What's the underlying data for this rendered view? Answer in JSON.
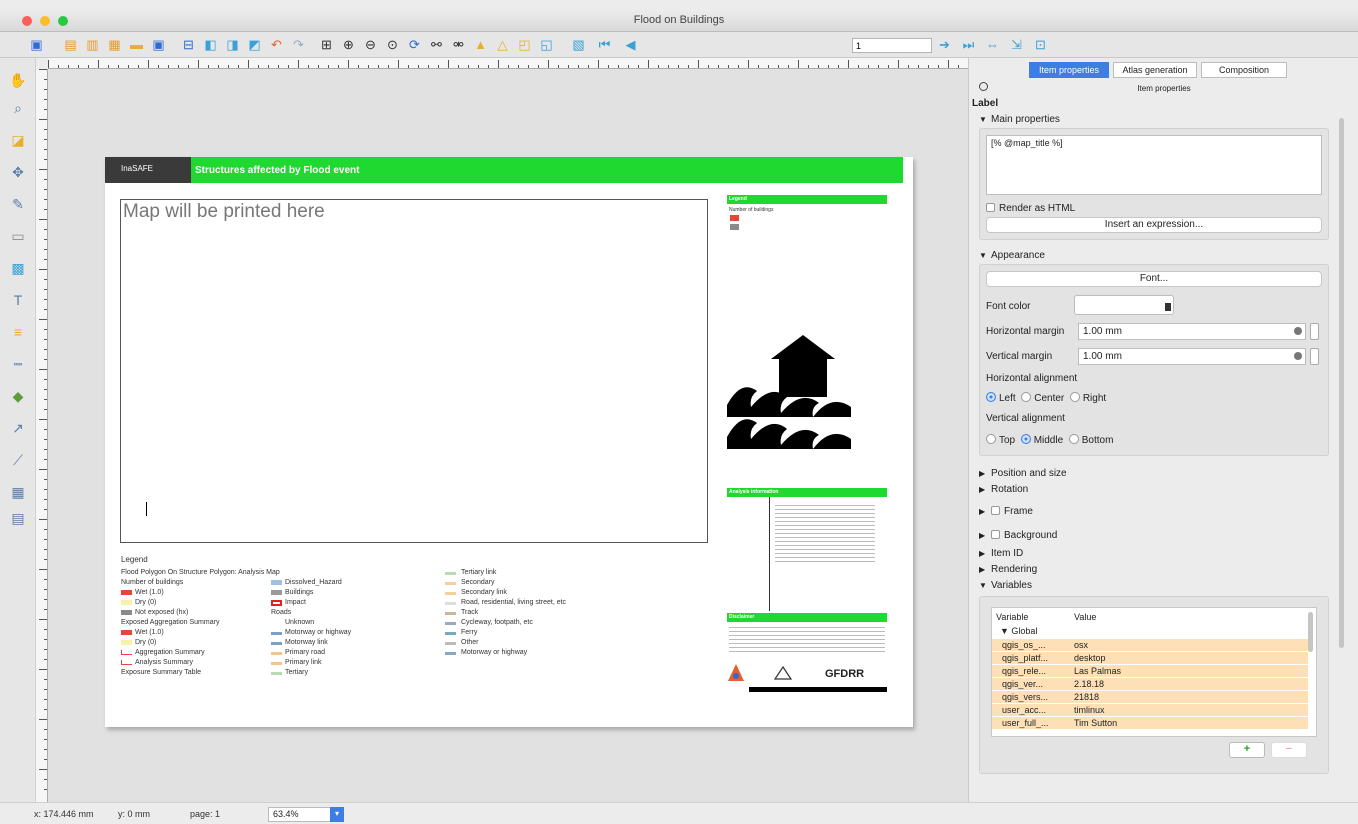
{
  "window": {
    "title": "Flood on Buildings"
  },
  "toolbar": {
    "atlas_page_value": "1"
  },
  "panel": {
    "tabs": [
      {
        "label": "Item properties",
        "active": true
      },
      {
        "label": "Atlas generation",
        "active": false
      },
      {
        "label": "Composition",
        "active": false
      }
    ],
    "title": "Item properties",
    "item_type": "Label",
    "sections": {
      "main_properties": "Main properties",
      "appearance": "Appearance",
      "position_and_size": "Position and size",
      "rotation": "Rotation",
      "frame": "Frame",
      "background": "Background",
      "item_id": "Item ID",
      "rendering": "Rendering",
      "variables": "Variables"
    },
    "label_text": "[% @map_title %]",
    "render_html_label": "Render as HTML",
    "insert_expression_label": "Insert an expression...",
    "font_button": "Font...",
    "font_color_label": "Font color",
    "h_margin_label": "Horizontal margin",
    "h_margin_value": "1.00 mm",
    "v_margin_label": "Vertical margin",
    "v_margin_value": "1.00 mm",
    "h_align_label": "Horizontal alignment",
    "h_align_options": [
      "Left",
      "Center",
      "Right"
    ],
    "v_align_label": "Vertical alignment",
    "v_align_options": [
      "Top",
      "Middle",
      "Bottom"
    ],
    "variables_table": {
      "col_variable": "Variable",
      "col_value": "Value",
      "group": "Global",
      "rows": [
        {
          "name": "qgis_os_...",
          "value": "osx"
        },
        {
          "name": "qgis_platf...",
          "value": "desktop"
        },
        {
          "name": "qgis_rele...",
          "value": "Las Palmas"
        },
        {
          "name": "qgis_ver...",
          "value": "2.18.18"
        },
        {
          "name": "qgis_vers...",
          "value": "21818"
        },
        {
          "name": "user_acc...",
          "value": "timlinux"
        },
        {
          "name": "user_full_...",
          "value": "Tim Sutton"
        }
      ],
      "add_glyph": "+",
      "remove_glyph": "−"
    }
  },
  "layout": {
    "header_logo_text": "InaSAFE",
    "header_title": "Structures affected by Flood event",
    "map_placeholder": "Map will be printed here",
    "legend_box_title": "Legend",
    "legend_box_sub": "Number of buildings",
    "analysis_title": "Analysis information",
    "disclaimer_title": "Disclaimer",
    "gfdrr_text": "GFDRR",
    "legend_title": "Legend",
    "legend_items": [
      {
        "text": "Flood Polygon On Structure Polygon: Analysis Map",
        "color": ""
      },
      {
        "text": "Number of buildings",
        "color": ""
      },
      {
        "text": "Wet (1.0)",
        "color": "#e8443a"
      },
      {
        "text": "Dry (0)",
        "color": "#f6f0a8"
      },
      {
        "text": "Not exposed (hx)",
        "color": "#8a8a8a"
      },
      {
        "text": "Exposed Aggregation Summary",
        "color": ""
      },
      {
        "text": "Wet (1.0)",
        "color": "#e8443a"
      },
      {
        "text": "Dry (0)",
        "color": "#f6f0a8"
      },
      {
        "text": "Aggregation Summary",
        "color": "#e8443a"
      },
      {
        "text": "Analysis Summary",
        "color": "#e8443a"
      },
      {
        "text": "Exposure Summary Table",
        "color": ""
      }
    ],
    "legend_col2": [
      {
        "text": "Dissolved_Hazard",
        "color": "#9fc0e0"
      },
      {
        "text": "Buildings",
        "color": "#9a9a9a"
      },
      {
        "text": "Impact",
        "color": "#d22"
      },
      {
        "text": "Roads",
        "color": ""
      },
      {
        "text": "Unknown",
        "color": ""
      },
      {
        "text": "Motorway or highway",
        "color": "#7aa0c8"
      },
      {
        "text": "Motorway link",
        "color": "#7aa0c8"
      },
      {
        "text": "Primary road",
        "color": "#f5c48a"
      },
      {
        "text": "Primary link",
        "color": "#f5c48a"
      },
      {
        "text": "Tertiary",
        "color": "#b9d9b2"
      }
    ],
    "legend_col3": [
      {
        "text": "Tertiary link",
        "color": "#b9d9b2"
      },
      {
        "text": "Secondary",
        "color": "#f2d0a0"
      },
      {
        "text": "Secondary link",
        "color": "#f2d0a0"
      },
      {
        "text": "Road, residential, living street, etc",
        "color": "#ddd"
      },
      {
        "text": "Track",
        "color": "#c9b89a"
      },
      {
        "text": "Cycleway, footpath, etc",
        "color": "#9ab"
      },
      {
        "text": "Ferry",
        "color": "#7ab"
      },
      {
        "text": "Other",
        "color": "#bbb"
      },
      {
        "text": "Motorway or highway",
        "color": "#8aa6c4"
      }
    ]
  },
  "status": {
    "x": "x: 174.446 mm",
    "y": "y: 0 mm",
    "page": "page: 1",
    "zoom": "63.4%"
  }
}
